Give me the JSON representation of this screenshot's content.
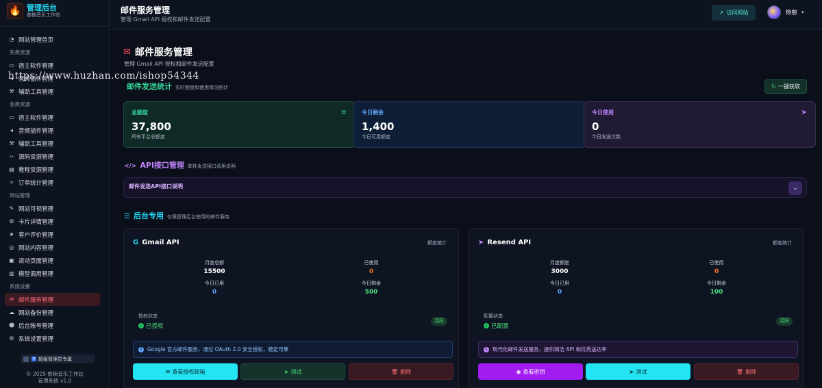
{
  "brand": {
    "title": "管理后台",
    "subtitle": "憨楠音乐工作站",
    "logo_icon": "flame-icon"
  },
  "watermark": "https://www.huzhan.com/ishop54344",
  "sidebar": {
    "items": [
      {
        "type": "item",
        "label": "网站管理首页",
        "icon": "dashboard-icon"
      },
      {
        "type": "section",
        "label": "免费资源"
      },
      {
        "type": "item",
        "label": "宿主软件管理",
        "icon": "desktop-icon"
      },
      {
        "type": "item",
        "label": "音频插件管理",
        "icon": "volume-icon"
      },
      {
        "type": "item",
        "label": "辅助工具管理",
        "icon": "wrench-icon"
      },
      {
        "type": "section",
        "label": "收费资源"
      },
      {
        "type": "item",
        "label": "宿主软件管理",
        "icon": "desktop-icon"
      },
      {
        "type": "item",
        "label": "音频插件管理",
        "icon": "volume-icon"
      },
      {
        "type": "item",
        "label": "辅助工具管理",
        "icon": "wrench-icon"
      },
      {
        "type": "item",
        "label": "源码资源管理",
        "icon": "code-icon"
      },
      {
        "type": "item",
        "label": "教程资源管理",
        "icon": "book-icon"
      },
      {
        "type": "item",
        "label": "订单统计管理",
        "icon": "cart-icon"
      },
      {
        "type": "section",
        "label": "网站管理"
      },
      {
        "type": "item",
        "label": "网站可视管理",
        "icon": "edit-icon"
      },
      {
        "type": "item",
        "label": "卡片详情管理",
        "icon": "cogs-icon"
      },
      {
        "type": "item",
        "label": "客户评价管理",
        "icon": "star-icon"
      },
      {
        "type": "item",
        "label": "网站内容管理",
        "icon": "globe-icon"
      },
      {
        "type": "item",
        "label": "滚动页面管理",
        "icon": "image-icon"
      },
      {
        "type": "item",
        "label": "模型调用管理",
        "icon": "database-icon"
      },
      {
        "type": "section",
        "label": "系统设置"
      },
      {
        "type": "item",
        "label": "邮件服务管理",
        "icon": "envelope-icon",
        "active": true
      },
      {
        "type": "item",
        "label": "网站备份管理",
        "icon": "cloud-upload-icon"
      },
      {
        "type": "item",
        "label": "后台账号管理",
        "icon": "users-icon"
      },
      {
        "type": "item",
        "label": "系统设置管理",
        "icon": "gear-icon"
      }
    ],
    "admin_badge": "超级管理员专属",
    "footer_line1": "© 2025 憨楠音乐工作站",
    "footer_line2": "管理系统 v1.0"
  },
  "topbar": {
    "title": "邮件服务管理",
    "subtitle": "管理 Gmail API 授权和邮件发送配置",
    "visit_label": "访问网站",
    "username": "杨憨"
  },
  "main": {
    "title": "邮件服务管理",
    "subtitle": "管理 Gmail API 授权和邮件发送配置",
    "stats_section": {
      "title": "邮件发送统计",
      "subtitle": "实时额度和使用情况统计",
      "fetch_label": "一键获取"
    },
    "stats": [
      {
        "label": "总额度",
        "value": "37,800",
        "desc": "所有平台总额度",
        "color": "#34d399",
        "icon": "database-icon"
      },
      {
        "label": "今日剩余",
        "value": "1,400",
        "desc": "今日可用额度",
        "color": "#60a5fa",
        "icon": ""
      },
      {
        "label": "今日使用",
        "value": "0",
        "desc": "今日发送次数",
        "color": "#c084fc",
        "icon": "paper-plane-icon"
      }
    ],
    "api_section": {
      "title": "API接口管理",
      "subtitle": "邮件发送接口调用说明",
      "panel_title": "邮件发送API接口说明"
    },
    "backend_section": {
      "title": "后台专用",
      "subtitle": "仅限管理后台使用的邮件服务"
    },
    "cards": [
      {
        "title": "Gmail API",
        "icon": "google-icon",
        "quota_label": "额度统计",
        "metrics": {
          "monthly_total": {
            "label": "月度总额",
            "value": "15500"
          },
          "used": {
            "label": "已使用",
            "value": "0"
          },
          "today_used": {
            "label": "今日已用",
            "value": "0"
          },
          "today_left": {
            "label": "今日剩余",
            "value": "500"
          }
        },
        "status_label": "授权状态",
        "status_value": "已授权",
        "status_badge": "活跃",
        "info": "Google 官方邮件服务，通过 OAuth 2.0 安全授权，稳定可靠",
        "buttons": {
          "primary": "查看授权邮箱",
          "test": "测试",
          "delete": "删除"
        }
      },
      {
        "title": "Resend API",
        "icon": "paper-plane-icon",
        "quota_label": "额度统计",
        "metrics": {
          "monthly_total": {
            "label": "月度额度",
            "value": "3000"
          },
          "used": {
            "label": "已使用",
            "value": "0"
          },
          "today_used": {
            "label": "今日已用",
            "value": "0"
          },
          "today_left": {
            "label": "今日剩余",
            "value": "100"
          }
        },
        "status_label": "配置状态",
        "status_value": "已配置",
        "status_badge": "活跃",
        "info": "现代化邮件发送服务，提供简洁 API 和优秀送达率",
        "buttons": {
          "primary": "查看密钥",
          "test": "测试",
          "delete": "删除"
        }
      }
    ]
  }
}
